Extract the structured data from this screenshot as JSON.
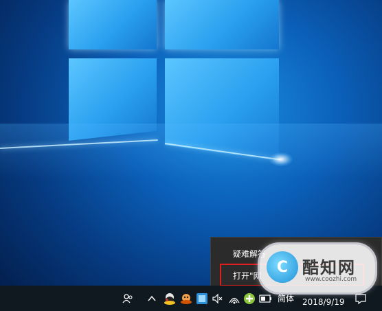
{
  "desktop": {
    "wallpaper": "windows-10-hero",
    "colors": {
      "deep": "#021a44",
      "mid": "#0b5fb8",
      "light": "#5cc6ff"
    }
  },
  "context_menu": {
    "items": [
      {
        "label": "疑难解答"
      },
      {
        "label": "打开\"网"
      }
    ],
    "highlight_color": "#e01e1e"
  },
  "taskbar": {
    "icons": [
      "people-icon",
      "chevron-up-icon",
      "qq-app-icon",
      "qq-app-icon-2",
      "app-tray-icon",
      "volume-muted-icon",
      "network-icon",
      "security-app-icon",
      "battery-icon",
      "action-center-icon"
    ],
    "ime_label": "简体",
    "date": "2018/9/19"
  },
  "watermark": {
    "name": "酷知网",
    "url": "www.coozhi.com",
    "logo_letter": "C"
  }
}
